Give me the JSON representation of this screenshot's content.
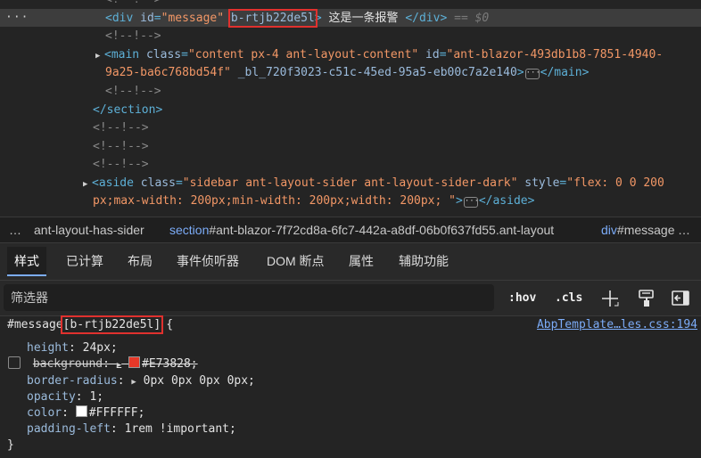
{
  "dom_tree": {
    "line0": "<!--!-->",
    "message_div": {
      "open": "<div",
      "attr_name": "id",
      "attr_value": "\"message\"",
      "scope_attr": "b-rtjb22de5l",
      "gt": ">",
      "text": "这是一条报警",
      "close": "</div>",
      "eq": "==",
      "console_ref": "$0"
    },
    "comment": "<!--!-->",
    "main": {
      "open": "<main",
      "class_name": "class",
      "class_value": "\"content px-4 ant-layout-content\"",
      "id_name": "id",
      "id_value_1": "\"ant-blazor-493db1b8-7851-4940-",
      "id_value_2": "9a25-ba6c768bd54f\"",
      "bl_attr": "_bl_720f3023-c51c-45ed-95a5-eb00c7a2e140",
      "gt": ">",
      "close": "</main>"
    },
    "section_close": "</section>",
    "aside": {
      "open": "<aside",
      "class_name": "class",
      "class_value": "\"sidebar ant-layout-sider ant-layout-sider-dark\"",
      "style_name": "style",
      "style_value_1": "\"flex: 0 0 200",
      "style_value_2": "px;max-width: 200px;min-width: 200px;width: 200px; \"",
      "gt": ">",
      "close": "</aside>"
    }
  },
  "breadcrumb": {
    "item1": "ant-layout-has-sider",
    "item2_tag": "section",
    "item2_id": "#ant-blazor-7f72cd8a-6fc7-442a-a8df-06b0f637fd55.ant-layout",
    "item3_tag": "div",
    "item3_id": "#message"
  },
  "tabs": [
    "样式",
    "已计算",
    "布局",
    "事件侦听器",
    "DOM 断点",
    "属性",
    "辅助功能"
  ],
  "filter": {
    "placeholder": "筛选器",
    "hov": ":hov",
    "cls": ".cls"
  },
  "icons": [
    "plus-icon",
    "paint-brush-icon",
    "sidebar-toggle-icon",
    "expand-triangle-icon",
    "ellipsis-icon"
  ],
  "style_rule": {
    "selector": "#message",
    "scope": "[b-rtjb22de5l]",
    "open_brace": "{",
    "close_brace": "}",
    "source": "AbpTemplate…les.css:194",
    "props": [
      {
        "name": "height",
        "value": "24px;"
      },
      {
        "name": "background",
        "value": "#E73828;",
        "disabled": true,
        "swatch": "#E73828"
      },
      {
        "name": "border-radius",
        "value": "0px 0px 0px 0px;"
      },
      {
        "name": "opacity",
        "value": "1;"
      },
      {
        "name": "color",
        "value": "#FFFFFF;",
        "swatch": "#FFFFFF"
      },
      {
        "name": "padding-left",
        "value": "1rem !important;"
      }
    ]
  },
  "colors": {
    "highlight_box": "#e0312e",
    "link": "#7cacf8",
    "tag": "#5db0d7",
    "attr_value": "#f29766"
  }
}
